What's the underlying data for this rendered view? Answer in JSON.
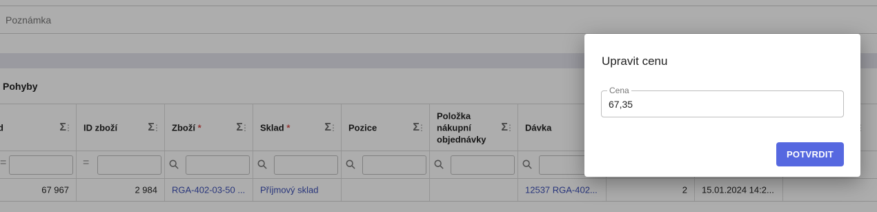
{
  "note": {
    "label": "Poznámka"
  },
  "section": {
    "title": "Pohyby"
  },
  "grid": {
    "headers": [
      {
        "label": "d",
        "required": false
      },
      {
        "label": "ID zboží",
        "required": false
      },
      {
        "label": "Zboží",
        "required": true
      },
      {
        "label": "Sklad",
        "required": true
      },
      {
        "label": "Pozice",
        "required": false
      },
      {
        "label": "Položka nákupní objednávky",
        "required": false
      },
      {
        "label": "Dávka",
        "required": false
      }
    ],
    "row": {
      "c0": "67 967",
      "c1": "2 984",
      "c2": "RGA-402-03-50 ...",
      "c3": "Příjmový sklad",
      "c6": "12537 RGA-402...",
      "c7": "2",
      "c8": "15.01.2024 14:2..."
    },
    "sigma": "Σ",
    "required_mark": "*"
  },
  "dialog": {
    "title": "Upravit cenu",
    "field_label": "Cena",
    "field_value": "67,35",
    "confirm_label": "POTVRDIT"
  },
  "colors": {
    "accent": "#5668e0",
    "link": "#3c4fb5",
    "required": "#d9534f"
  }
}
